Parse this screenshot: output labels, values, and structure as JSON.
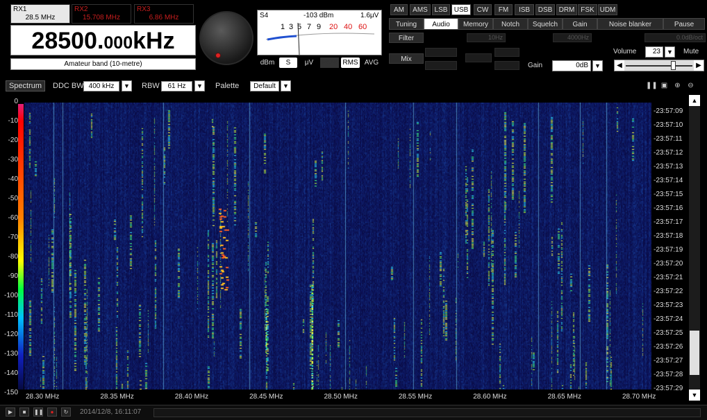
{
  "receivers": [
    {
      "name": "RX1",
      "freq": "28.5 MHz"
    },
    {
      "name": "RX2",
      "freq": "15.708 MHz"
    },
    {
      "name": "RX3",
      "freq": "6.86 MHz"
    }
  ],
  "frequency": {
    "main": "28500.",
    "small": "000",
    "unit": "kHz"
  },
  "band_label": "Amateur band (10-metre)",
  "smeter": {
    "label": "S4",
    "dbm": "-103 dBm",
    "uv": "1.6μV",
    "ticks": [
      "1",
      "3",
      "5",
      "7",
      "9",
      "20",
      "40",
      "60"
    ],
    "buttons": {
      "dbm": "dBm",
      "s": "S",
      "uv": "μV",
      "peak": "Peak",
      "rms": "RMS",
      "avg": "AVG"
    }
  },
  "modes": [
    "AM",
    "AMS",
    "LSB",
    "USB",
    "CW",
    "FM",
    "ISB",
    "DSB",
    "DRM",
    "FSK",
    "UDM"
  ],
  "active_mode": "USB",
  "function_tabs": [
    "Tuning",
    "Audio",
    "Memory",
    "Notch",
    "Squelch",
    "Gain",
    "Noise blanker",
    "Pause"
  ],
  "active_tab": "Audio",
  "audio": {
    "filter_label": "Filter",
    "mix_label": "Mix",
    "low_cut": "10Hz",
    "high_cut": "4000Hz",
    "slope": "0.0dB/oct",
    "gain_label": "Gain",
    "gain_value": "0dB",
    "volume_label": "Volume",
    "volume_value": "23",
    "mute_label": "Mute",
    "volume_fraction": 0.73
  },
  "toolbar": {
    "spectrum_label": "Spectrum",
    "ddcbw_label": "DDC BW",
    "ddcbw_value": "400 kHz",
    "rbw_label": "RBW",
    "rbw_value": "61 Hz",
    "palette_label": "Palette",
    "palette_value": "Default"
  },
  "y_labels": [
    "0",
    "-10",
    "-20",
    "-30",
    "-40",
    "-50",
    "-60",
    "-70",
    "-80",
    "-90",
    "-100",
    "-110",
    "-120",
    "-130",
    "-140",
    "-150"
  ],
  "time_labels": [
    "-23:57:09",
    "-23:57:10",
    "-23:57:11",
    "-23:57:12",
    "-23:57:13",
    "-23:57:14",
    "-23:57:15",
    "-23:57:16",
    "-23:57:17",
    "-23:57:18",
    "-23:57:19",
    "-23:57:20",
    "-23:57:21",
    "-23:57:22",
    "-23:57:23",
    "-23:57:24",
    "-23:57:25",
    "-23:57:26",
    "-23:57:27",
    "-23:57:28",
    "-23:57:29"
  ],
  "x_labels": [
    "28.30 MHz",
    "28.35 MHz",
    "28.40 MHz",
    "28.45 MHz",
    "28.50 MHz",
    "28.55 MHz",
    "28.60 MHz",
    "28.65 MHz",
    "28.70 MHz"
  ],
  "timestamp": "2014/12/8, 16:11:07",
  "colors": {
    "accent_red": "#c81e1e",
    "waterfall_bg": "#0a0d4a"
  }
}
